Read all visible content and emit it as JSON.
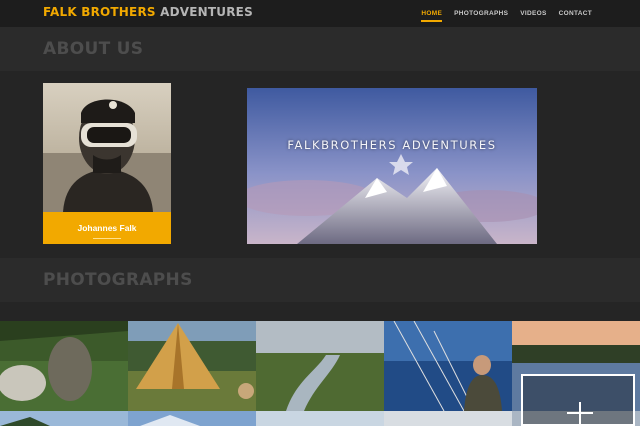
{
  "brand": {
    "part1": "FALK BROTHERS",
    "part2": "ADVENTURES"
  },
  "nav": {
    "items": [
      {
        "label": "HOME",
        "active": true
      },
      {
        "label": "PHOTOGRAPHS",
        "active": false
      },
      {
        "label": "VIDEOS",
        "active": false
      },
      {
        "label": "CONTACT",
        "active": false
      }
    ]
  },
  "about": {
    "heading": "ABOUT US",
    "profile_name": "Johannes Falk",
    "banner_title": "FALKBROTHERS ADVENTURES"
  },
  "photographs": {
    "heading": "PHOTOGRAPHS"
  },
  "colors": {
    "accent": "#f2a900",
    "background": "#252525",
    "band": "#2b2b2b",
    "heading": "#4d4d4d"
  },
  "icons": {
    "gallery_overlay": "plus-icon"
  }
}
